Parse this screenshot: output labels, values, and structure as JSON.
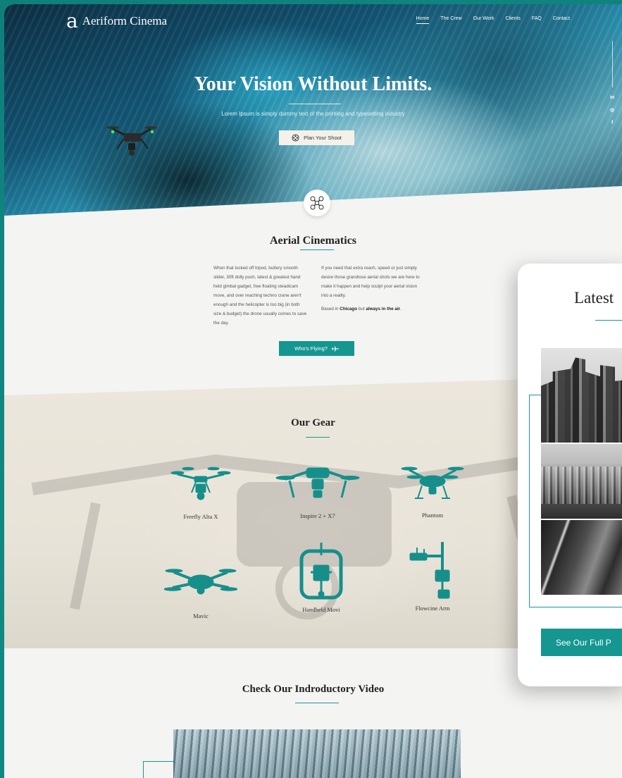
{
  "nav": {
    "logo_mark": "a",
    "brand": "Aeriform Cinema",
    "items": [
      {
        "label": "Home",
        "active": true
      },
      {
        "label": "The Crew",
        "active": false
      },
      {
        "label": "Our Work",
        "active": false
      },
      {
        "label": "Clients",
        "active": false
      },
      {
        "label": "FAQ",
        "active": false
      },
      {
        "label": "Contact",
        "active": false
      }
    ]
  },
  "social": {
    "items": [
      "in",
      "◎",
      "f"
    ]
  },
  "hero": {
    "title": "Your Vision Without Limits.",
    "subtitle": "Lorem Ipsum is simply dummy text of the printing and typesetting industry",
    "cta": "Plan Your Shoot"
  },
  "aerial": {
    "title": "Aerial Cinematics",
    "col1": "When that locked off tripod, buttery smooth slider, 30ft dolly push, latest & greatest hand held gimbal gadget, free floating steadicam move, and over reaching techno crane aren't enough and the helicopter is too big (in both size & budget) the drone usually comes to save the day.",
    "col2a": "If you need that extra reach, speed or just simply desire those grandiose aerial shots we are here to make it happen and help sculpt your aerial vision into a reality.",
    "col2b_prefix": "Based in ",
    "col2b_city": "Chicago",
    "col2b_mid": " but ",
    "col2b_end": "always in the air",
    "col2b_dot": ".",
    "cta": "Who's Flying?"
  },
  "gear": {
    "title": "Our Gear",
    "items": [
      {
        "label": "Freefly Alta X",
        "icon": "hexacopter-icon"
      },
      {
        "label": "Inspire 2 + X7",
        "icon": "inspire-drone-icon"
      },
      {
        "label": "Phantom",
        "icon": "quadcopter-icon"
      },
      {
        "label": "Mavic",
        "icon": "mavic-drone-icon"
      },
      {
        "label": "Handheld Movi",
        "icon": "gimbal-icon"
      },
      {
        "label": "Flowcine Arm",
        "icon": "camera-arm-icon"
      }
    ]
  },
  "video": {
    "title": "Check Our Indroductory Video"
  },
  "card": {
    "title": "Latest",
    "cta": "See Our Full P"
  },
  "colors": {
    "accent": "#159690",
    "background": "#12958e",
    "paper": "#f4f4f3"
  }
}
